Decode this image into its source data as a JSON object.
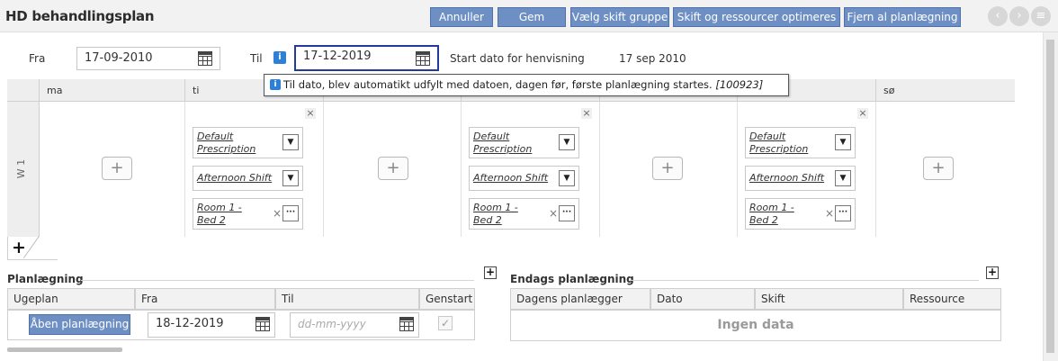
{
  "header": {
    "title": "HD behandlingsplan",
    "buttons": [
      "Annuller",
      "Gem",
      "Vælg skift gruppe",
      "Skift og ressourcer optimeres",
      "Fjern al planlægning"
    ],
    "nav": [
      "‹",
      "›",
      "≡"
    ]
  },
  "filters": {
    "from_label": "Fra",
    "from_value": "17-09-2010",
    "to_label": "Til",
    "to_value": "17-12-2019",
    "start_label": "Start dato for henvisning",
    "start_value": "17 sep 2010"
  },
  "tooltip": {
    "text": "Til dato, blev automatikt udfylt med datoen, dagen før, første planlægning startes.",
    "code": "[100923]"
  },
  "week": {
    "days": [
      "ma",
      "ti",
      "",
      "",
      "",
      "",
      "sø"
    ],
    "row_label": "W 1",
    "slot": {
      "prescription": "Default Prescription",
      "shift": "Afternoon Shift",
      "room": "Room 1 - Bed 2"
    }
  },
  "planning": {
    "title": "Planlægning",
    "columns": [
      "Ugeplan",
      "Fra",
      "Til",
      "Genstart"
    ],
    "open_button": "Åben planlægning",
    "from_value": "18-12-2019",
    "to_placeholder": "dd-mm-yyyy",
    "restart_checked": "✓"
  },
  "oneday": {
    "title": "Endags planlægning",
    "columns": [
      "Dagens planlægger",
      "Dato",
      "Skift",
      "Ressource"
    ],
    "empty": "Ingen data"
  },
  "colors": {
    "button": "#6d8fc4",
    "focus": "#223a9c",
    "info": "#2f7fd6"
  }
}
